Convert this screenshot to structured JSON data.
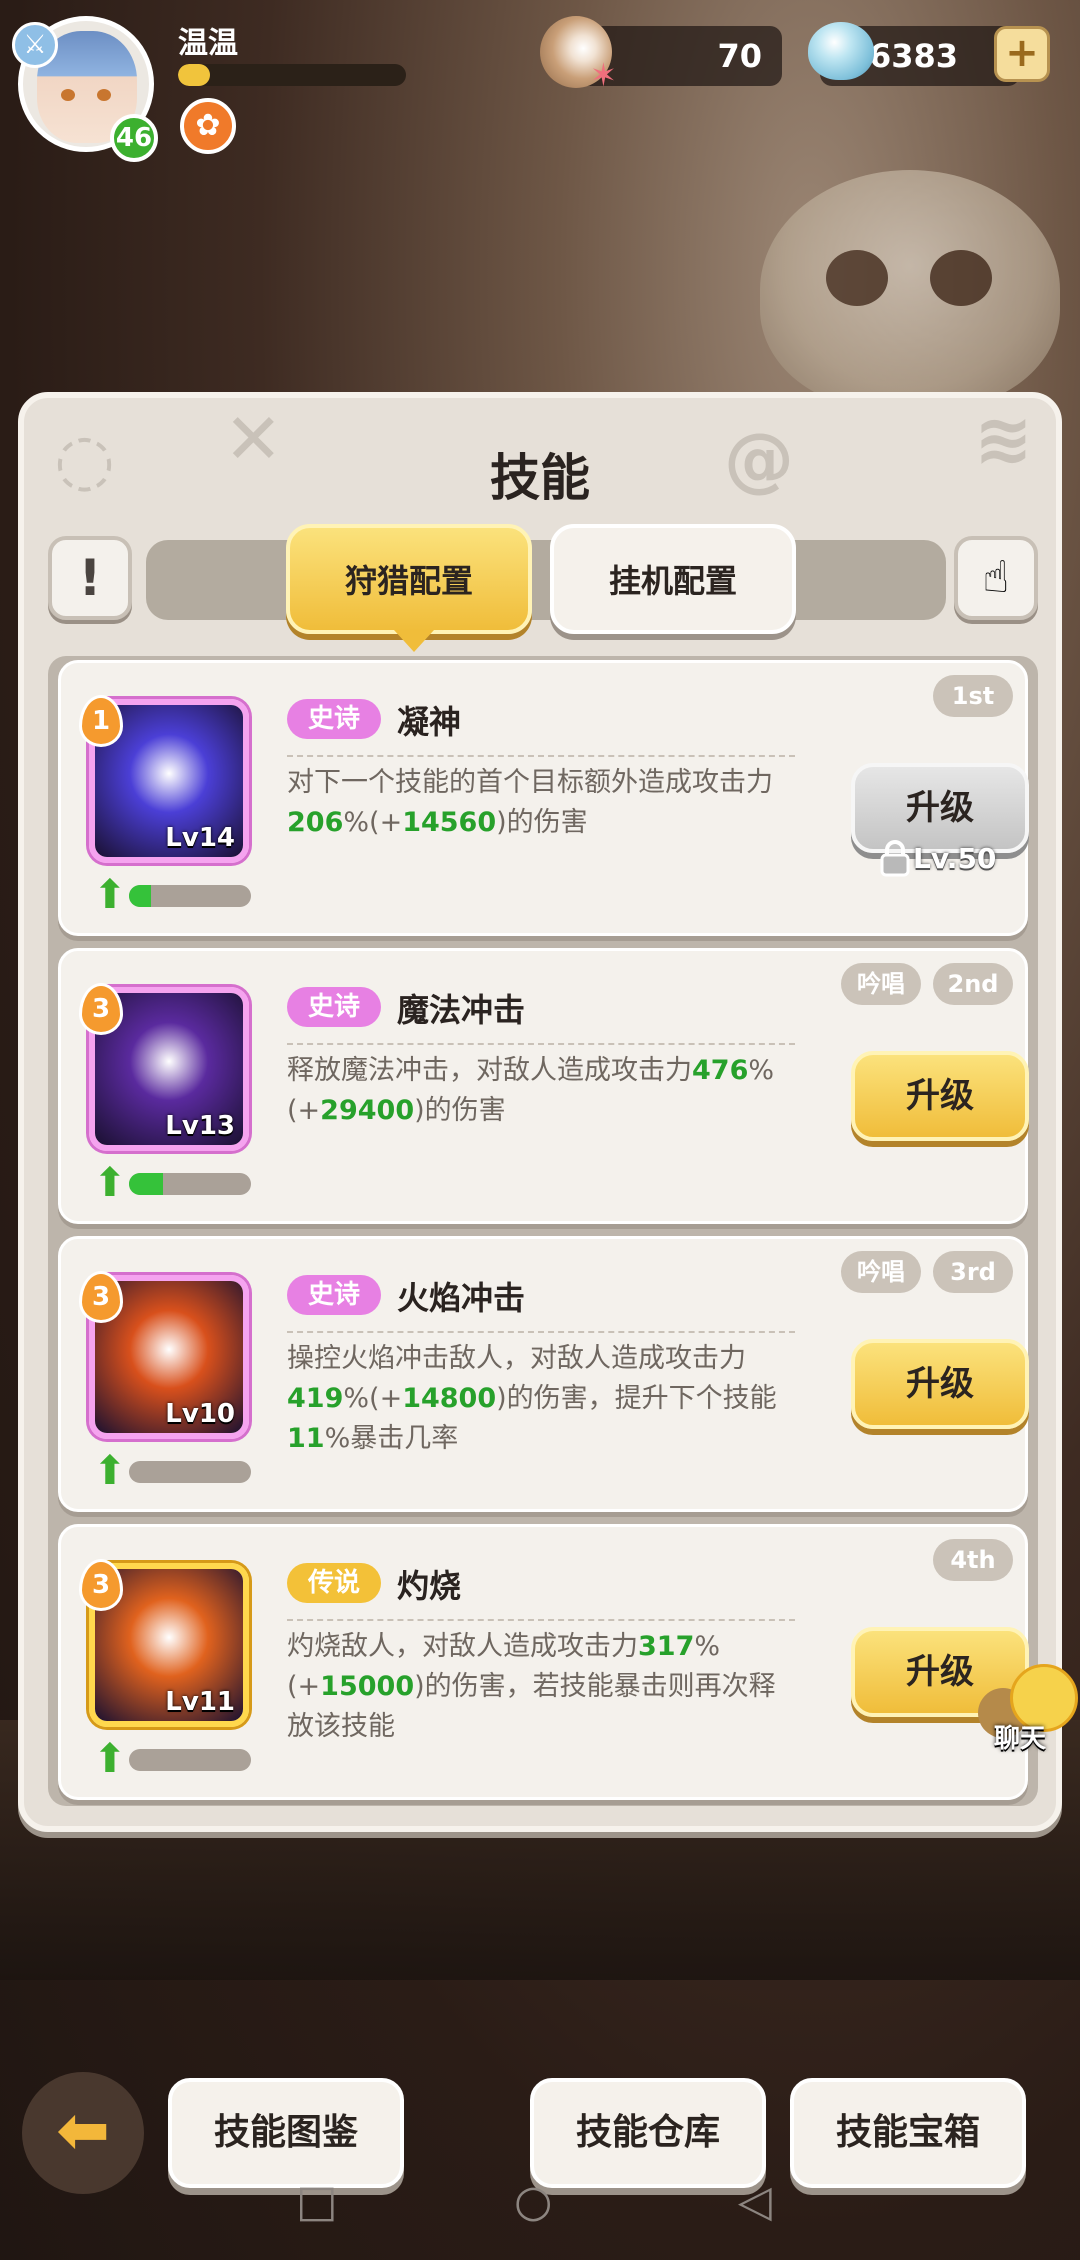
{
  "player": {
    "name": "温温",
    "level": "46",
    "xp_fraction": 0.14
  },
  "resources": {
    "pearls": "70",
    "diamonds": "56383"
  },
  "panel": {
    "title": "技能"
  },
  "tabs": {
    "hunt": "狩猎配置",
    "idle": "挂机配置",
    "active": "hunt"
  },
  "skills": [
    {
      "rank": "1",
      "icon_level": "Lv14",
      "rarity": "史诗",
      "name": "凝神",
      "desc": [
        "对下一个技能的首个目标额外造成攻击力",
        {
          "g": "206"
        },
        "%(+",
        {
          "g": "14560"
        },
        ")的伤害"
      ],
      "tags": [
        "1st"
      ],
      "upgrade": "升级",
      "locked": true,
      "lock_level": "Lv.50",
      "progress": 0.18,
      "icon_color": "#4b3fd6"
    },
    {
      "rank": "3",
      "icon_level": "Lv13",
      "rarity": "史诗",
      "name": "魔法冲击",
      "desc": [
        "释放魔法冲击，对敌人造成攻击力",
        {
          "g": "476"
        },
        "%(+",
        {
          "g": "29400"
        },
        ")的伤害"
      ],
      "tags": [
        "吟唱",
        "2nd"
      ],
      "upgrade": "升级",
      "locked": false,
      "progress": 0.28,
      "icon_color": "#5a2a9e"
    },
    {
      "rank": "3",
      "icon_level": "Lv10",
      "rarity": "史诗",
      "name": "火焰冲击",
      "desc": [
        "操控火焰冲击敌人，对敌人造成攻击力",
        {
          "g": "419"
        },
        "%(+",
        {
          "g": "14800"
        },
        ")的伤害，提升下个技能",
        {
          "g": "11"
        },
        "%暴击几率"
      ],
      "tags": [
        "吟唱",
        "3rd"
      ],
      "upgrade": "升级",
      "locked": false,
      "progress": 0,
      "icon_color": "#d8501c"
    },
    {
      "rank": "3",
      "icon_level": "Lv11",
      "rarity": "传说",
      "name": "灼烧",
      "desc": [
        "灼烧敌人，对敌人造成攻击力",
        {
          "g": "317"
        },
        "%(+",
        {
          "g": "15000"
        },
        ")的伤害，若技能暴击则再次释放该技能"
      ],
      "tags": [
        "4th"
      ],
      "upgrade": "升级",
      "locked": false,
      "progress": 0,
      "icon_color": "#e0621e"
    }
  ],
  "chat": {
    "label": "聊天"
  },
  "bottom": {
    "compendium": "技能图鉴",
    "storage": "技能仓库",
    "chest": "技能宝箱"
  },
  "colors": {
    "accent_yellow": "#f0bd3a",
    "epic_pink": "#e780e3",
    "legend_gold": "#f3c138",
    "value_green": "#27a12b"
  }
}
